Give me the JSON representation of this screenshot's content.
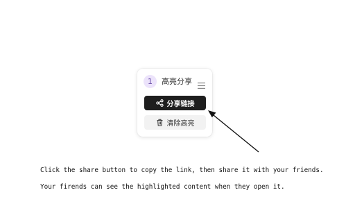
{
  "highlight_card": {
    "count": "1",
    "title": "高亮分享",
    "menu_icon": "hamburger-menu-icon",
    "share_button": {
      "label": "分享链接",
      "icon": "share-icon"
    },
    "clear_button": {
      "label": "清除高亮",
      "icon": "trash-icon"
    }
  },
  "instructions": {
    "line1": "Click the share button to copy the link, then share it with your friends.",
    "line2": "Your firends can see the highlighted content when they open it."
  },
  "colors": {
    "share_button_bg": "#1e1e1e",
    "clear_button_bg": "#f2f2f2",
    "badge_bg": "#ece3fb",
    "badge_text": "#6b4fa8"
  }
}
